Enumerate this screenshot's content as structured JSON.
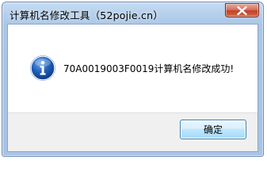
{
  "window": {
    "title": "计算机名修改工具（52pojie.cn）"
  },
  "dialog": {
    "icon": "info-icon",
    "message": "70A0019003F0019计算机名修改成功!"
  },
  "buttons": {
    "ok_label": "确定",
    "close_icon": "close-icon"
  },
  "colors": {
    "title_bar": "#b6d0ec",
    "close_button": "#c2412a",
    "info_icon": "#1f5fb7",
    "ok_button_border": "#3c7fb1"
  }
}
